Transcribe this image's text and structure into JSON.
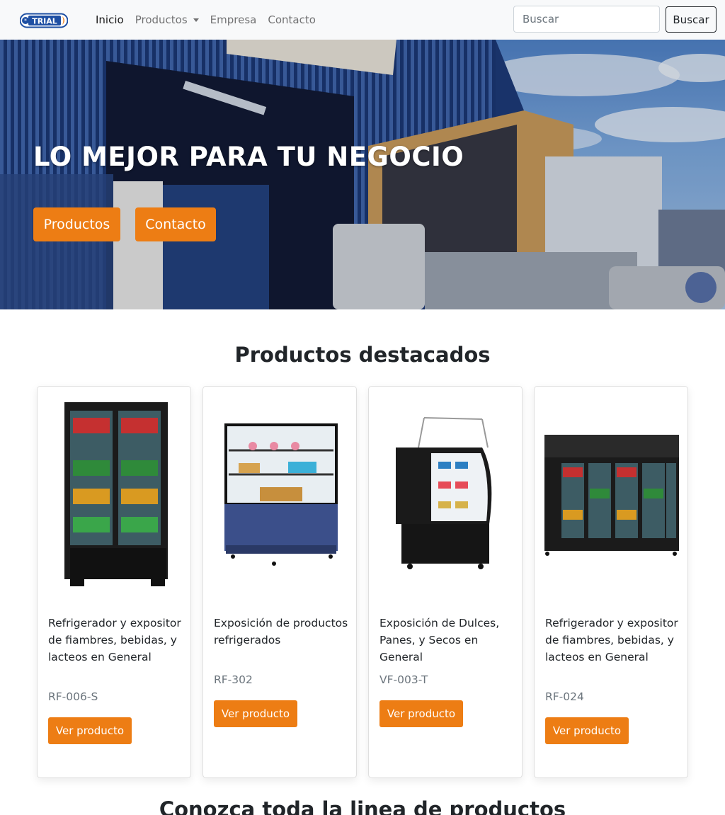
{
  "navbar": {
    "brand": "TRIAL",
    "items": [
      {
        "label": "Inicio"
      },
      {
        "label": "Productos"
      },
      {
        "label": "Empresa"
      },
      {
        "label": "Contacto"
      }
    ],
    "search_placeholder": "Buscar",
    "search_button": "Buscar"
  },
  "hero": {
    "title": "LO MEJOR PARA TU NEGOCIO",
    "buttons": [
      {
        "label": "Productos"
      },
      {
        "label": "Contacto"
      }
    ]
  },
  "featured": {
    "title": "Productos destacados",
    "products": [
      {
        "title": "Refrigerador y expositor de fiambres, bebidas, y lacteos en General",
        "code": "RF-006-S",
        "button": "Ver producto"
      },
      {
        "title": "Exposición de productos refrigerados",
        "code": "RF-302",
        "button": "Ver producto"
      },
      {
        "title": "Exposición de Dulces, Panes, y Secos en General",
        "code": "VF-003-T",
        "button": "Ver producto"
      },
      {
        "title": "Refrigerador y expositor de fiambres, bebidas, y lacteos en General",
        "code": "RF-024",
        "button": "Ver producto"
      }
    ]
  },
  "bottom": {
    "title": "Conozca toda la linea de productos"
  },
  "colors": {
    "accent": "#ed7d14",
    "navbar_bg": "#f8f9fa"
  }
}
